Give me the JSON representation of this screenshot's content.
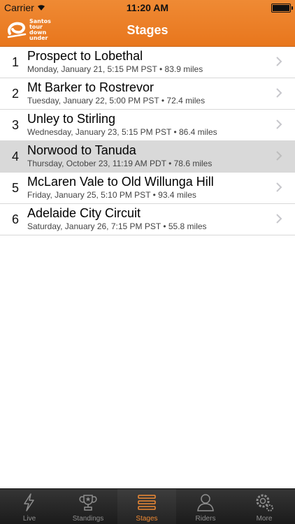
{
  "status_bar": {
    "carrier": "Carrier",
    "time": "11:20 AM"
  },
  "nav": {
    "title": "Stages",
    "logo_lines": [
      "Santos",
      "tour",
      "down",
      "under"
    ]
  },
  "stages": [
    {
      "number": "1",
      "title": "Prospect to Lobethal",
      "subtitle": "Monday, January 21, 5:15 PM PST • 83.9 miles"
    },
    {
      "number": "2",
      "title": "Mt Barker to Rostrevor",
      "subtitle": "Tuesday, January 22, 5:00 PM PST • 72.4 miles"
    },
    {
      "number": "3",
      "title": "Unley to Stirling",
      "subtitle": "Wednesday, January 23, 5:15 PM PST • 86.4 miles"
    },
    {
      "number": "4",
      "title": "Norwood to Tanuda",
      "subtitle": "Thursday, October 23, 11:19 AM PDT • 78.6 miles",
      "selected": true
    },
    {
      "number": "5",
      "title": "McLaren Vale to Old Willunga Hill",
      "subtitle": "Friday, January 25, 5:10 PM PST • 93.4 miles"
    },
    {
      "number": "6",
      "title": "Adelaide City Circuit",
      "subtitle": "Saturday, January 26, 7:15 PM PST • 55.8 miles"
    }
  ],
  "tabs": [
    {
      "label": "Live",
      "icon": "lightning-icon"
    },
    {
      "label": "Standings",
      "icon": "trophy-icon"
    },
    {
      "label": "Stages",
      "icon": "list-icon",
      "active": true
    },
    {
      "label": "Riders",
      "icon": "person-icon"
    },
    {
      "label": "More",
      "icon": "gear-icon"
    }
  ],
  "colors": {
    "accent": "#ef8a34",
    "selected_row": "#d9d9d9",
    "tab_inactive": "#8e8e8e"
  }
}
